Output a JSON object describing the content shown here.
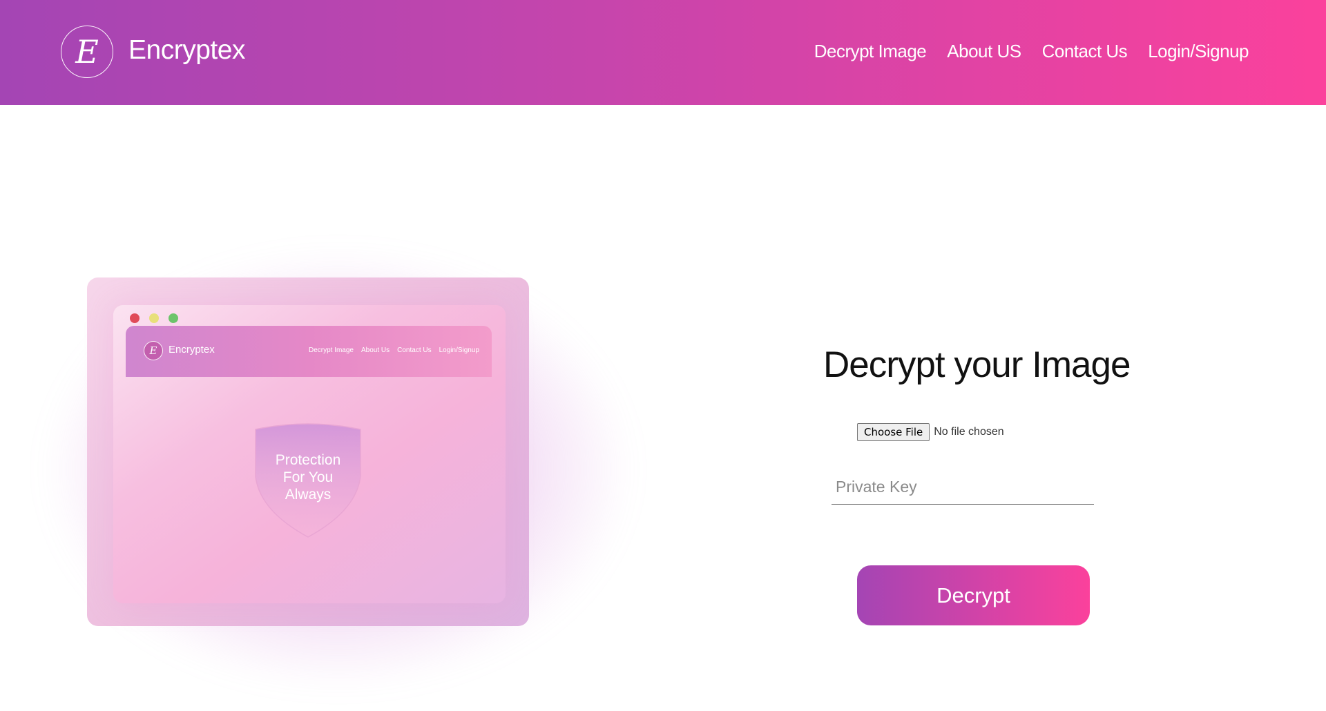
{
  "header": {
    "logo_letter": "E",
    "brand": "Encryptex",
    "nav": [
      {
        "label": "Decrypt Image"
      },
      {
        "label": "About US"
      },
      {
        "label": "Contact Us"
      },
      {
        "label": "Login/Signup"
      }
    ]
  },
  "illustration": {
    "mock_brand": "Encryptex",
    "mock_logo_letter": "E",
    "mock_nav": [
      "Decrypt Image",
      "About Us",
      "Contact Us",
      "Login/Signup"
    ],
    "shield_text": "Protection\nFor You\nAlways"
  },
  "form": {
    "title": "Decrypt your Image",
    "file_button": "Choose File",
    "file_status": "No file chosen",
    "key_placeholder": "Private Key",
    "key_value": "",
    "submit_label": "Decrypt"
  },
  "colors": {
    "gradient_start": "#a445b4",
    "gradient_end": "#fb419c"
  }
}
